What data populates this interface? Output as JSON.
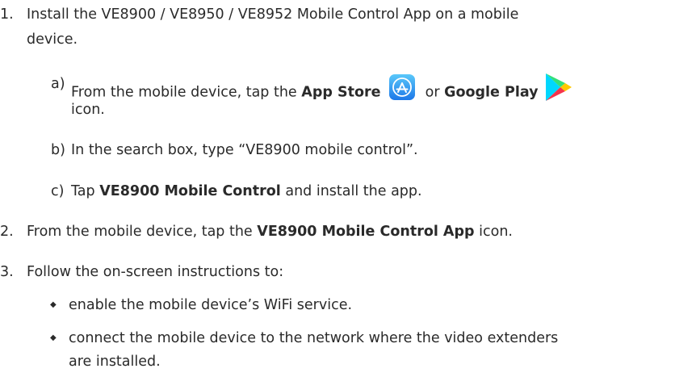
{
  "steps": {
    "s1": {
      "number": "1.",
      "line1": "Install the VE8900 / VE8950 / VE8952 Mobile Control App on a mobile",
      "line2": "device.",
      "sub_a": {
        "marker": "a)",
        "pre": "From the mobile device, tap the",
        "app_store": "App Store",
        "or": "or",
        "google_play": "Google Play",
        "line2": "icon."
      },
      "sub_b": {
        "marker": "b)",
        "text": "In the search box, type “VE8900 mobile control”."
      },
      "sub_c": {
        "marker": "c)",
        "pre": "Tap",
        "bold": "VE8900 Mobile Control",
        "post": "and install the app."
      }
    },
    "s2": {
      "number": "2.",
      "pre": "From the mobile device, tap the",
      "bold": "VE8900 Mobile Control App",
      "post": "icon."
    },
    "s3": {
      "number": "3.",
      "text": "Follow the on-screen instructions to:",
      "bullets": {
        "b1": "enable the mobile device’s WiFi service.",
        "b2_line1": "connect the mobile device to the network where the video extenders",
        "b2_line2": "are installed."
      }
    }
  },
  "icons": {
    "app_store": "app-store-icon",
    "google_play": "google-play-icon",
    "bullet": "diamond-bullet-icon"
  },
  "colors": {
    "text": "#2a2a2a",
    "app_store_blue": "#1d9bf0"
  }
}
